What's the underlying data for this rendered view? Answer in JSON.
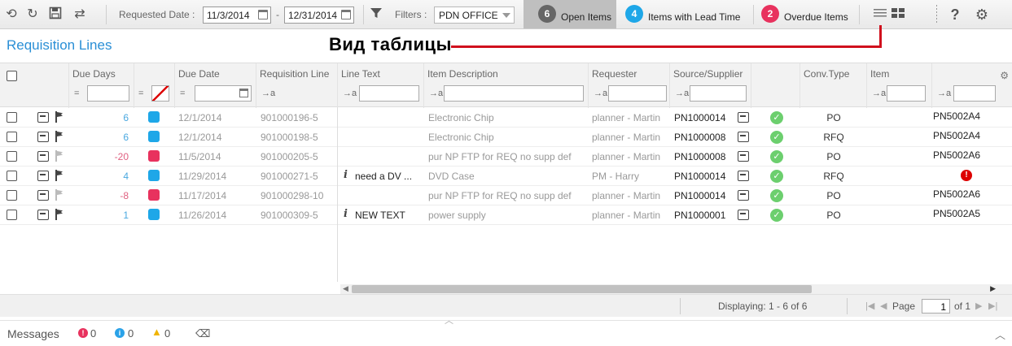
{
  "toolbar": {
    "requested_date_label": "Requested Date :",
    "date_from": "11/3/2014",
    "date_dash": "-",
    "date_to": "12/31/2014",
    "filters_label": "Filters :",
    "filter_value": "PDN OFFICE",
    "open_items": {
      "count": "6",
      "label": "Open Items",
      "color": "#666666"
    },
    "lead_time": {
      "count": "4",
      "label": "Items with Lead Time",
      "color": "#1ea7e8"
    },
    "overdue": {
      "count": "2",
      "label": "Overdue Items",
      "color": "#e8325e"
    },
    "help_label": "?"
  },
  "title": "Requisition Lines",
  "annotation": "Вид таблицы",
  "columns": {
    "due_days": "Due Days",
    "due_date": "Due Date",
    "requisition_line": "Requisition Line",
    "line_text": "Line Text",
    "item_description": "Item Description",
    "requester": "Requester",
    "source_supplier": "Source/Supplier",
    "conv_type": "Conv.Type",
    "item": "Item"
  },
  "filter_ops": {
    "eq": "=",
    "text": "→a"
  },
  "rows": [
    {
      "due_days": "6",
      "swatch": "#1ea7e8",
      "due_date": "12/1/2014",
      "req_line": "901000196-5",
      "line_text": "",
      "has_info": false,
      "description": "Electronic Chip",
      "requester": "planner - Martin",
      "supplier": "PN1000014",
      "conv_type": "PO",
      "item": "PN5002A4",
      "days_color": "#4aa8e0",
      "flag_color": "#444444"
    },
    {
      "due_days": "6",
      "swatch": "#1ea7e8",
      "due_date": "12/1/2014",
      "req_line": "901000198-5",
      "line_text": "",
      "has_info": false,
      "description": "Electronic Chip",
      "requester": "planner - Martin",
      "supplier": "PN1000008",
      "conv_type": "RFQ",
      "item": "PN5002A4",
      "days_color": "#4aa8e0",
      "flag_color": "#444444"
    },
    {
      "due_days": "-20",
      "swatch": "#e8325e",
      "due_date": "11/5/2014",
      "req_line": "901000205-5",
      "line_text": "",
      "has_info": false,
      "description": "pur NP FTP for REQ no supp def",
      "requester": "planner - Martin",
      "supplier": "PN1000008",
      "conv_type": "PO",
      "item": "PN5002A6",
      "days_color": "#e06080",
      "flag_color": "#bbbbbb"
    },
    {
      "due_days": "4",
      "swatch": "#1ea7e8",
      "due_date": "11/29/2014",
      "req_line": "901000271-5",
      "line_text": "need a DV ...",
      "has_info": true,
      "description": "DVD Case",
      "requester": "PM - Harry",
      "supplier": "PN1000014",
      "conv_type": "RFQ",
      "item": "",
      "days_color": "#4aa8e0",
      "flag_color": "#444444"
    },
    {
      "due_days": "-8",
      "swatch": "#e8325e",
      "due_date": "11/17/2014",
      "req_line": "901000298-10",
      "line_text": "",
      "has_info": false,
      "description": "pur NP FTP for REQ no supp def",
      "requester": "planner - Martin",
      "supplier": "PN1000014",
      "conv_type": "PO",
      "item": "PN5002A6",
      "days_color": "#e06080",
      "flag_color": "#bbbbbb"
    },
    {
      "due_days": "1",
      "swatch": "#1ea7e8",
      "due_date": "11/26/2014",
      "req_line": "901000309-5",
      "line_text": "NEW TEXT",
      "has_info": true,
      "description": "power supply",
      "requester": "planner - Martin",
      "supplier": "PN1000001",
      "conv_type": "PO",
      "item": "PN5002A5",
      "days_color": "#4aa8e0",
      "flag_color": "#444444"
    }
  ],
  "pager": {
    "displaying": "Displaying: 1 - 6 of 6",
    "page_label": "Page",
    "page_value": "1",
    "of_label": "of 1"
  },
  "messages": {
    "label": "Messages",
    "errors": "0",
    "info": "0",
    "warnings": "0"
  }
}
